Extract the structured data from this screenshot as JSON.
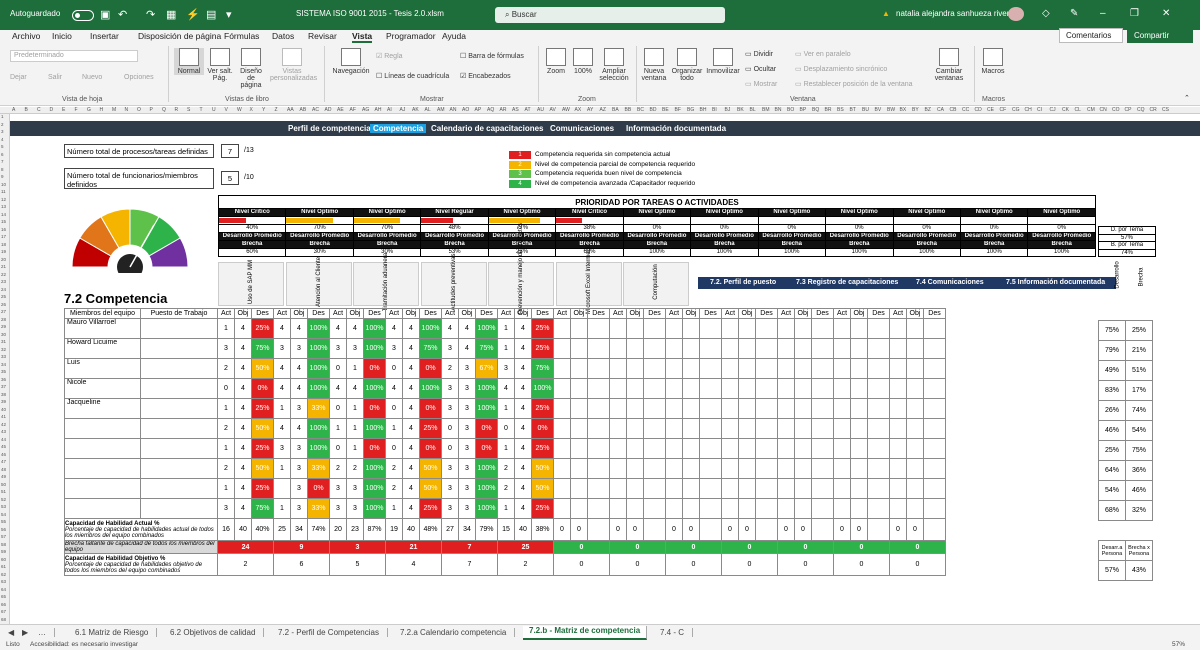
{
  "titlebar": {
    "autosave": "Autoguardado",
    "filename": "SISTEMA ISO 9001 2015 - Tesis 2.0.xlsm",
    "search_placeholder": "Buscar",
    "user": "natalia alejandra sanhueza rivera"
  },
  "menu": [
    "Archivo",
    "Inicio",
    "Insertar",
    "Disposición de página",
    "Fórmulas",
    "Datos",
    "Revisar",
    "Vista",
    "Programador",
    "Ayuda"
  ],
  "menu_active": "Vista",
  "top_buttons": {
    "comments": "Comentarios",
    "share": "Compartir"
  },
  "ribbon": {
    "vista_hoja": {
      "dropdown": "Predeterminado",
      "mantener": "Dejar",
      "salir": "Salir",
      "nuevo": "Nuevo",
      "opciones": "Opciones",
      "group": "Vista de hoja"
    },
    "vistas_libro": {
      "normal": "Normal",
      "ver_salt": "Ver salt. Pág.",
      "diseno": "Diseño de página",
      "vistas_pers": "Vistas personalizadas",
      "group": "Vistas de libro"
    },
    "mostrar": {
      "navegacion": "Navegación",
      "regla": "Regla",
      "lineas": "Líneas de cuadrícula",
      "barra": "Barra de fórmulas",
      "encabezados": "Encabezados",
      "group": "Mostrar"
    },
    "zoom": {
      "zoom": "Zoom",
      "cien": "100%",
      "ampliar": "Ampliar selección",
      "group": "Zoom"
    },
    "ventana": {
      "nueva": "Nueva ventana",
      "organizar": "Organizar todo",
      "inmovilizar": "Inmovilizar",
      "dividir": "Dividir",
      "ocultar": "Ocultar",
      "mostrar": "Mostrar",
      "paralelo": "Ver en paralelo",
      "desplaz": "Desplazamiento sincrónico",
      "restablecer": "Restablecer posición de la ventana",
      "cambiar": "Cambiar ventanas",
      "group": "Ventana"
    },
    "macros": {
      "macros": "Macros",
      "group": "Macros"
    }
  },
  "columns": [
    "A",
    "B",
    "C",
    "D",
    "E",
    "F",
    "G",
    "H",
    "M",
    "N",
    "O",
    "P",
    "Q",
    "R",
    "S",
    "T",
    "U",
    "V",
    "W",
    "X",
    "Y",
    "Z",
    "AA",
    "AB",
    "AC",
    "AD",
    "AE",
    "AF",
    "AG",
    "AH",
    "AI",
    "AJ",
    "AK",
    "AL",
    "AM",
    "AN",
    "AO",
    "AP",
    "AQ",
    "AR",
    "AS",
    "AT",
    "AU",
    "AV",
    "AW",
    "AX",
    "AY",
    "AZ",
    "BA",
    "BB",
    "BC",
    "BD",
    "BE",
    "BF",
    "BG",
    "BH",
    "BI",
    "BJ",
    "BK",
    "BL",
    "BM",
    "BN",
    "BO",
    "BP",
    "BQ",
    "BR",
    "BS",
    "BT",
    "BU",
    "BV",
    "BW",
    "BX",
    "BY",
    "BZ",
    "CA",
    "CB",
    "CC",
    "CD",
    "CE",
    "CF",
    "CG",
    "CH",
    "CI",
    "CJ",
    "CK",
    "CL",
    "CM",
    "CN",
    "CO",
    "CP",
    "CQ",
    "CR",
    "CS"
  ],
  "rows": [
    "1",
    "2",
    "3",
    "4",
    "5",
    "6",
    "7",
    "8",
    "9",
    "10",
    "11",
    "12",
    "13",
    "14",
    "15",
    "16",
    "17",
    "18",
    "19",
    "20",
    "21",
    "22",
    "23",
    "24",
    "25",
    "26",
    "27",
    "28",
    "29",
    "30",
    "31",
    "32",
    "33",
    "34",
    "35",
    "36",
    "37",
    "38",
    "39",
    "40",
    "41",
    "42",
    "43",
    "44",
    "45",
    "46",
    "47",
    "48",
    "49",
    "50",
    "51",
    "52",
    "53",
    "54",
    "55",
    "56",
    "57",
    "58",
    "59",
    "60",
    "61",
    "62",
    "63",
    "64",
    "65",
    "66",
    "67",
    "68"
  ],
  "nav": {
    "items": [
      "Perfil de competencia",
      "Competencia",
      "Calendario de capacitaciones",
      "Comunicaciones",
      "Información documentada"
    ],
    "active": "Competencia"
  },
  "counts": {
    "procesos_label": "Número total de procesos/tareas definidas",
    "procesos_value": "7",
    "procesos_total": "/13",
    "funcionarios_label": "Número total de funcionarios/miembros definidos",
    "funcionarios_value": "5",
    "funcionarios_total": "/10"
  },
  "legend": [
    {
      "num": "1",
      "color": "#e02020",
      "text": "Competencia requerida sin competencia actual"
    },
    {
      "num": "2",
      "color": "#f4b400",
      "text": "Nivel de competencia parcial de competencia requerido"
    },
    {
      "num": "3",
      "color": "#5ec24a",
      "text": "Competencia requerida buen nivel de competencia"
    },
    {
      "num": "4",
      "color": "#2db34a",
      "text": "Nivel de competencia avanzada /Capacitador requerido"
    }
  ],
  "priority": {
    "title": "PRIORIDAD POR TAREAS O ACTIVIDADES",
    "dev_label": "Desarrollo Promedio",
    "gap_label": "Brecha",
    "cols": [
      {
        "level": "Nivel Critico",
        "dev": "40%",
        "gap": "60%",
        "bar": "#e02020"
      },
      {
        "level": "Nivel Optimo",
        "dev": "70%",
        "gap": "30%",
        "bar": "#f4b400"
      },
      {
        "level": "Nivel Optimo",
        "dev": "70%",
        "gap": "30%",
        "bar": "#f4b400"
      },
      {
        "level": "Nivel Regular",
        "dev": "48%",
        "gap": "53%",
        "bar": "#e02020"
      },
      {
        "level": "Nivel Optimo",
        "dev": "77%",
        "gap": "23%",
        "bar": "#f4b400"
      },
      {
        "level": "Nivel Critico",
        "dev": "38%",
        "gap": "63%",
        "bar": "#e02020"
      },
      {
        "level": "Nivel Optimo",
        "dev": "0%",
        "gap": "100%",
        "bar": ""
      },
      {
        "level": "Nivel Optimo",
        "dev": "0%",
        "gap": "100%",
        "bar": ""
      },
      {
        "level": "Nivel Optimo",
        "dev": "0%",
        "gap": "100%",
        "bar": ""
      },
      {
        "level": "Nivel Optimo",
        "dev": "0%",
        "gap": "100%",
        "bar": ""
      },
      {
        "level": "Nivel Optimo",
        "dev": "0%",
        "gap": "100%",
        "bar": ""
      },
      {
        "level": "Nivel Optimo",
        "dev": "0%",
        "gap": "100%",
        "bar": ""
      },
      {
        "level": "Nivel Optimo",
        "dev": "0%",
        "gap": "100%",
        "bar": ""
      }
    ],
    "dtema_label": "D. por Tema",
    "dtema_value": "57%",
    "btema_label": "B. por Tema",
    "btema_value": "74%"
  },
  "section_title": "7.2 Competencia",
  "skills": [
    "Uso de SAP MM",
    "Atención al Cliente",
    "Tramitación aduanera",
    "Actitudes preventivas",
    "Prevención y manejo de conflictos",
    "Microsoft Excel Intermedio",
    "Computación"
  ],
  "blue_links": [
    "7.2. Perfil de puesto",
    "7.3 Registro de capacitaciones",
    "7.4 Comunicaciones",
    "7.5 Información documentada"
  ],
  "side_headers": {
    "desarrollo": "Desarrollo",
    "brecha": "Brecha"
  },
  "table_headers": {
    "member": "Miembros del equipo",
    "position": "Puesto de Trabajo",
    "act": "Act",
    "obj": "Obj",
    "des": "Des"
  },
  "members": [
    "Mauro Villarroel",
    "Howard Licuime",
    "Luis",
    "Nicole",
    "Jacqueline",
    "",
    "",
    "",
    "",
    ""
  ],
  "matrix": [
    [
      [
        "1",
        "4",
        "25%"
      ],
      [
        "4",
        "4",
        "100%"
      ],
      [
        "4",
        "4",
        "100%"
      ],
      [
        "4",
        "4",
        "100%"
      ],
      [
        "4",
        "4",
        "100%"
      ],
      [
        "1",
        "4",
        "25%"
      ]
    ],
    [
      [
        "3",
        "4",
        "75%"
      ],
      [
        "3",
        "3",
        "100%"
      ],
      [
        "3",
        "3",
        "100%"
      ],
      [
        "3",
        "4",
        "75%"
      ],
      [
        "3",
        "4",
        "75%"
      ],
      [
        "1",
        "4",
        "25%"
      ]
    ],
    [
      [
        "2",
        "4",
        "50%"
      ],
      [
        "4",
        "4",
        "100%"
      ],
      [
        "0",
        "1",
        "0%"
      ],
      [
        "0",
        "4",
        "0%"
      ],
      [
        "2",
        "3",
        "67%"
      ],
      [
        "3",
        "4",
        "75%"
      ]
    ],
    [
      [
        "0",
        "4",
        "0%"
      ],
      [
        "4",
        "4",
        "100%"
      ],
      [
        "4",
        "4",
        "100%"
      ],
      [
        "4",
        "4",
        "100%"
      ],
      [
        "3",
        "3",
        "100%"
      ],
      [
        "4",
        "4",
        "100%"
      ]
    ],
    [
      [
        "1",
        "4",
        "25%"
      ],
      [
        "1",
        "3",
        "33%"
      ],
      [
        "0",
        "1",
        "0%"
      ],
      [
        "0",
        "4",
        "0%"
      ],
      [
        "3",
        "3",
        "100%"
      ],
      [
        "1",
        "4",
        "25%"
      ]
    ],
    [
      [
        "2",
        "4",
        "50%"
      ],
      [
        "4",
        "4",
        "100%"
      ],
      [
        "1",
        "1",
        "100%"
      ],
      [
        "1",
        "4",
        "25%"
      ],
      [
        "0",
        "3",
        "0%"
      ],
      [
        "0",
        "4",
        "0%"
      ]
    ],
    [
      [
        "1",
        "4",
        "25%"
      ],
      [
        "3",
        "3",
        "100%"
      ],
      [
        "0",
        "1",
        "0%"
      ],
      [
        "0",
        "4",
        "0%"
      ],
      [
        "0",
        "3",
        "0%"
      ],
      [
        "1",
        "4",
        "25%"
      ]
    ],
    [
      [
        "2",
        "4",
        "50%"
      ],
      [
        "1",
        "3",
        "33%"
      ],
      [
        "2",
        "2",
        "100%"
      ],
      [
        "2",
        "4",
        "50%"
      ],
      [
        "3",
        "3",
        "100%"
      ],
      [
        "2",
        "4",
        "50%"
      ]
    ],
    [
      [
        "1",
        "4",
        "25%"
      ],
      [
        "",
        "3",
        "0%"
      ],
      [
        "3",
        "3",
        "100%"
      ],
      [
        "2",
        "4",
        "50%"
      ],
      [
        "3",
        "3",
        "100%"
      ],
      [
        "2",
        "4",
        "50%"
      ]
    ],
    [
      [
        "3",
        "4",
        "75%"
      ],
      [
        "1",
        "3",
        "33%"
      ],
      [
        "3",
        "3",
        "100%"
      ],
      [
        "1",
        "4",
        "25%"
      ],
      [
        "3",
        "3",
        "100%"
      ],
      [
        "1",
        "4",
        "25%"
      ]
    ]
  ],
  "row_dev": [
    "75%",
    "79%",
    "49%",
    "83%",
    "26%",
    "46%",
    "25%",
    "64%",
    "54%",
    "68%"
  ],
  "row_gap": [
    "25%",
    "21%",
    "51%",
    "17%",
    "74%",
    "54%",
    "75%",
    "36%",
    "46%",
    "32%"
  ],
  "cap_actual": {
    "title": "Capacidad de Habilidad Actual %",
    "desc": "Porcentaje de capacidad de habilidades actual de todos los miembros del equipo combinados",
    "values": [
      [
        "16",
        "40",
        "40%"
      ],
      [
        "25",
        "34",
        "74%"
      ],
      [
        "20",
        "23",
        "87%"
      ],
      [
        "19",
        "40",
        "48%"
      ],
      [
        "27",
        "34",
        "79%"
      ],
      [
        "15",
        "40",
        "38%"
      ],
      [
        "0",
        "0",
        ""
      ],
      [
        "0",
        "0",
        ""
      ],
      [
        "0",
        "0",
        ""
      ],
      [
        "0",
        "0",
        ""
      ],
      [
        "0",
        "0",
        ""
      ],
      [
        "0",
        "0",
        ""
      ],
      [
        "0",
        "0",
        ""
      ]
    ]
  },
  "brecha_row": {
    "desc": "Brecha faltante de capacidad de todos los miembros del equipo",
    "values": [
      "24",
      "9",
      "3",
      "21",
      "7",
      "25",
      "0",
      "0",
      "0",
      "0",
      "0",
      "0",
      "0"
    ],
    "desarrollo_persona": "Desarr.a Persona",
    "brecha_persona": "Brecha x Persona"
  },
  "cap_obj": {
    "title": "Capacidad de Habilidad Objetivo %",
    "desc": "Porcentaje de capacidad de habilidades objetivo de todos los miembros del equipo combinados",
    "values": [
      "2",
      "6",
      "5",
      "4",
      "7",
      "2",
      "0",
      "0",
      "0",
      "0",
      "0",
      "0",
      "0"
    ],
    "dev": "57%",
    "gap": "43%"
  },
  "gauge_colors": [
    "#c00000",
    "#e0751a",
    "#f4b400",
    "#5ec24a",
    "#2db34a",
    "#7030a0"
  ],
  "sheet_tabs": [
    "6.1 Matriz de Riesgo",
    "6.2 Objetivos de calidad",
    "7.2 - Perfil de Competencias",
    "7.2.a  Calendario competencia",
    "7.2.b - Matriz de competencia",
    "7.4 - C"
  ],
  "active_tab": "7.2.b - Matriz de competencia",
  "status": {
    "ready": "Listo",
    "accessibility": "Accesibilidad: es necesario investigar",
    "zoom": "57%"
  }
}
